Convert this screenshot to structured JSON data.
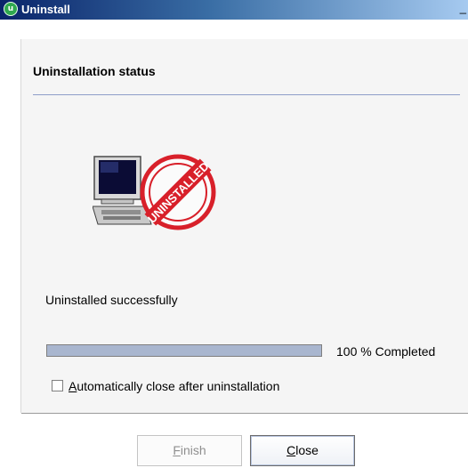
{
  "window": {
    "title": "Uninstall",
    "title_icon_glyph": "u",
    "title_icon": "uninstaller-app-icon",
    "title_edge_glyph": "_"
  },
  "header": {
    "title": "Uninstallation status"
  },
  "illustration": {
    "icon": "computer-uninstalled-icon",
    "stamp_text": "UNINSTALLED"
  },
  "status": {
    "message": "Uninstalled successfully"
  },
  "progress": {
    "value_percent": 100,
    "label": "100 % Completed"
  },
  "options": {
    "auto_close": {
      "label_accel": "A",
      "label_rest": "utomatically close after uninstallation",
      "checked": false
    }
  },
  "buttons": {
    "finish": {
      "accel": "F",
      "rest": "inish",
      "enabled": false
    },
    "close": {
      "accel": "C",
      "rest": "lose",
      "enabled": true
    }
  },
  "colors": {
    "stamp_red": "#d8202a",
    "progress_fill": "#a9b6cf",
    "title_bar": "#0a246a"
  }
}
